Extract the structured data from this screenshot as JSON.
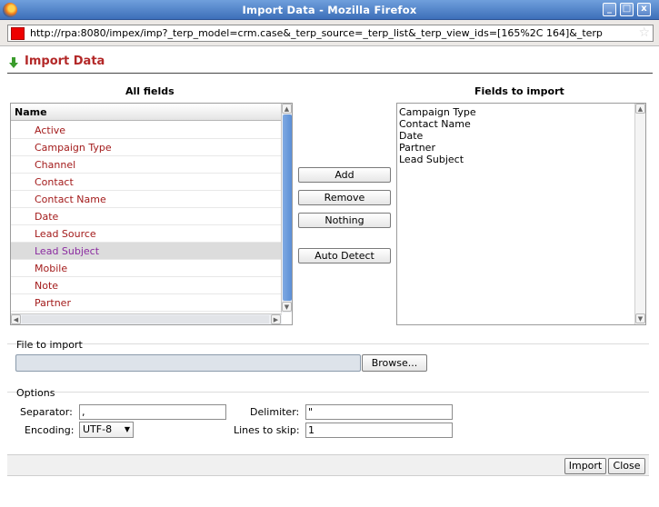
{
  "window": {
    "title": "Import Data - Mozilla Firefox",
    "minimize": "_",
    "maximize": "□",
    "close": "x"
  },
  "urlbar": {
    "url": "http://rpa:8080/impex/imp?_terp_model=crm.case&_terp_source=_terp_list&_terp_view_ids=[165%2C 164]&_terp"
  },
  "page": {
    "title": "Import Data",
    "title_color": "#b32828"
  },
  "all_fields": {
    "heading": "All fields",
    "column_header": "Name",
    "items": [
      "Active",
      "Campaign Type",
      "Channel",
      "Contact",
      "Contact Name",
      "Date",
      "Lead Source",
      "Lead Subject",
      "Mobile",
      "Note",
      "Partner"
    ],
    "selected": "Lead Subject"
  },
  "actions": {
    "add": "Add",
    "remove": "Remove",
    "nothing": "Nothing",
    "auto_detect": "Auto Detect"
  },
  "fields_to_import": {
    "heading": "Fields to import",
    "items": [
      "Campaign Type",
      "Contact Name",
      "Date",
      "Partner",
      "Lead Subject"
    ]
  },
  "file": {
    "legend": "File to import",
    "value": "",
    "browse": "Browse..."
  },
  "options": {
    "legend": "Options",
    "separator_label": "Separator:",
    "separator_value": ",",
    "delimiter_label": "Delimiter:",
    "delimiter_value": "\"",
    "encoding_label": "Encoding:",
    "encoding_value": "UTF-8",
    "lines_label": "Lines to skip:",
    "lines_value": "1"
  },
  "footer": {
    "import": "Import",
    "close": "Close"
  }
}
